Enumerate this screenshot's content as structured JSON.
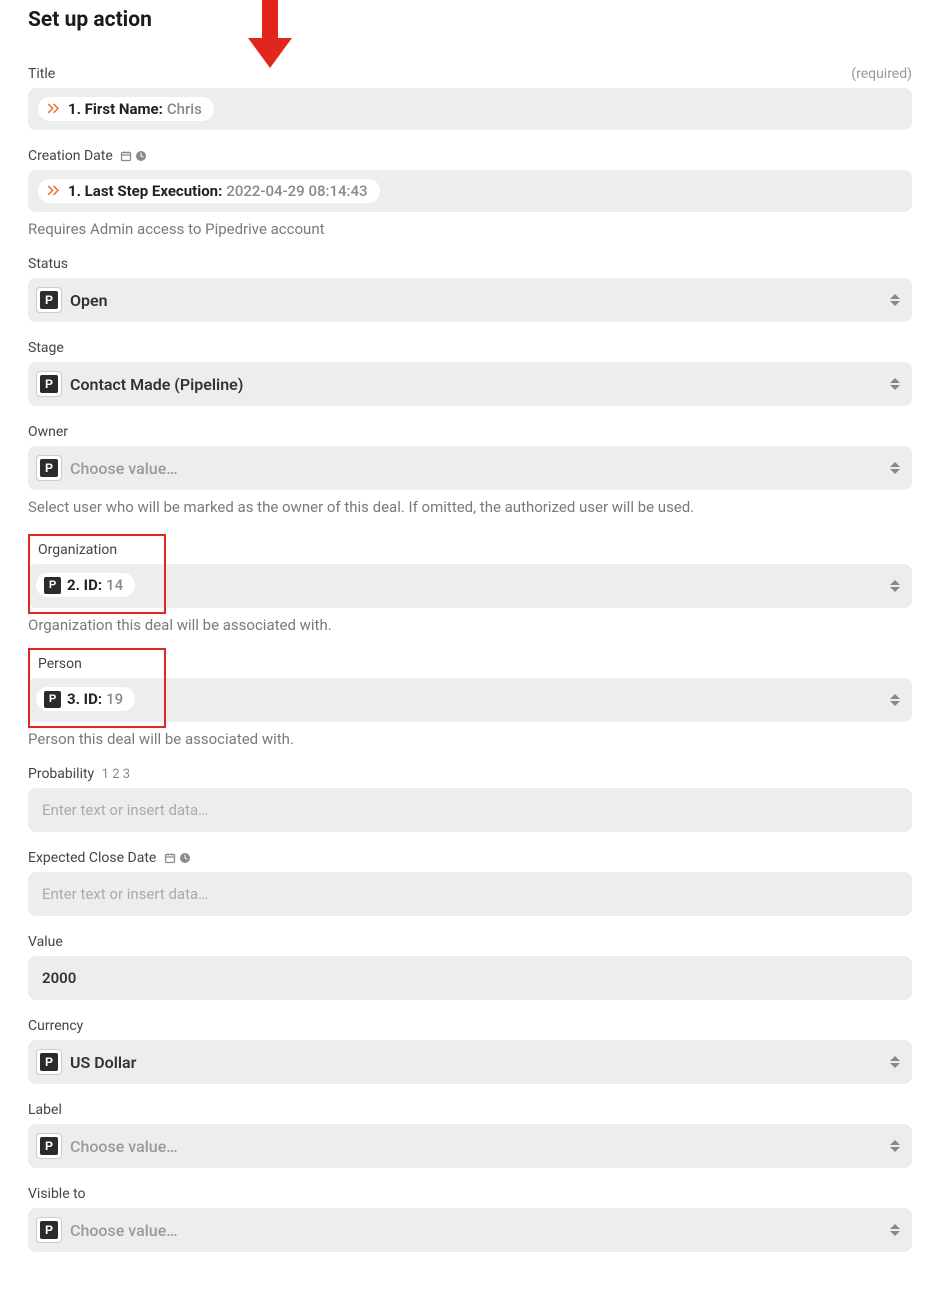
{
  "heading": "Set up action",
  "fields": {
    "title": {
      "label": "Title",
      "required": "(required)",
      "pill_label": "1. First Name:",
      "pill_value": "Chris"
    },
    "creation_date": {
      "label": "Creation Date",
      "pill_label": "1. Last Step Execution:",
      "pill_value": "2022-04-29 08:14:43",
      "help": "Requires Admin access to Pipedrive account"
    },
    "status": {
      "label": "Status",
      "value": "Open"
    },
    "stage": {
      "label": "Stage",
      "value": "Contact Made (Pipeline)"
    },
    "owner": {
      "label": "Owner",
      "placeholder": "Choose value…",
      "help": "Select user who will be marked as the owner of this deal. If omitted, the authorized user will be used."
    },
    "organization": {
      "label": "Organization",
      "pill_label": "2. ID:",
      "pill_value": "14",
      "help": "Organization this deal will be associated with."
    },
    "person": {
      "label": "Person",
      "pill_label": "3. ID:",
      "pill_value": "19",
      "help": "Person this deal will be associated with."
    },
    "probability": {
      "label": "Probability",
      "hint": "1 2 3",
      "placeholder": "Enter text or insert data…"
    },
    "expected_close": {
      "label": "Expected Close Date",
      "placeholder": "Enter text or insert data…"
    },
    "value": {
      "label": "Value",
      "value": "2000"
    },
    "currency": {
      "label": "Currency",
      "value": "US Dollar"
    },
    "label_field": {
      "label": "Label",
      "placeholder": "Choose value…"
    },
    "visible_to": {
      "label": "Visible to",
      "placeholder": "Choose value…"
    }
  },
  "icons": {
    "app_letter": "P"
  }
}
